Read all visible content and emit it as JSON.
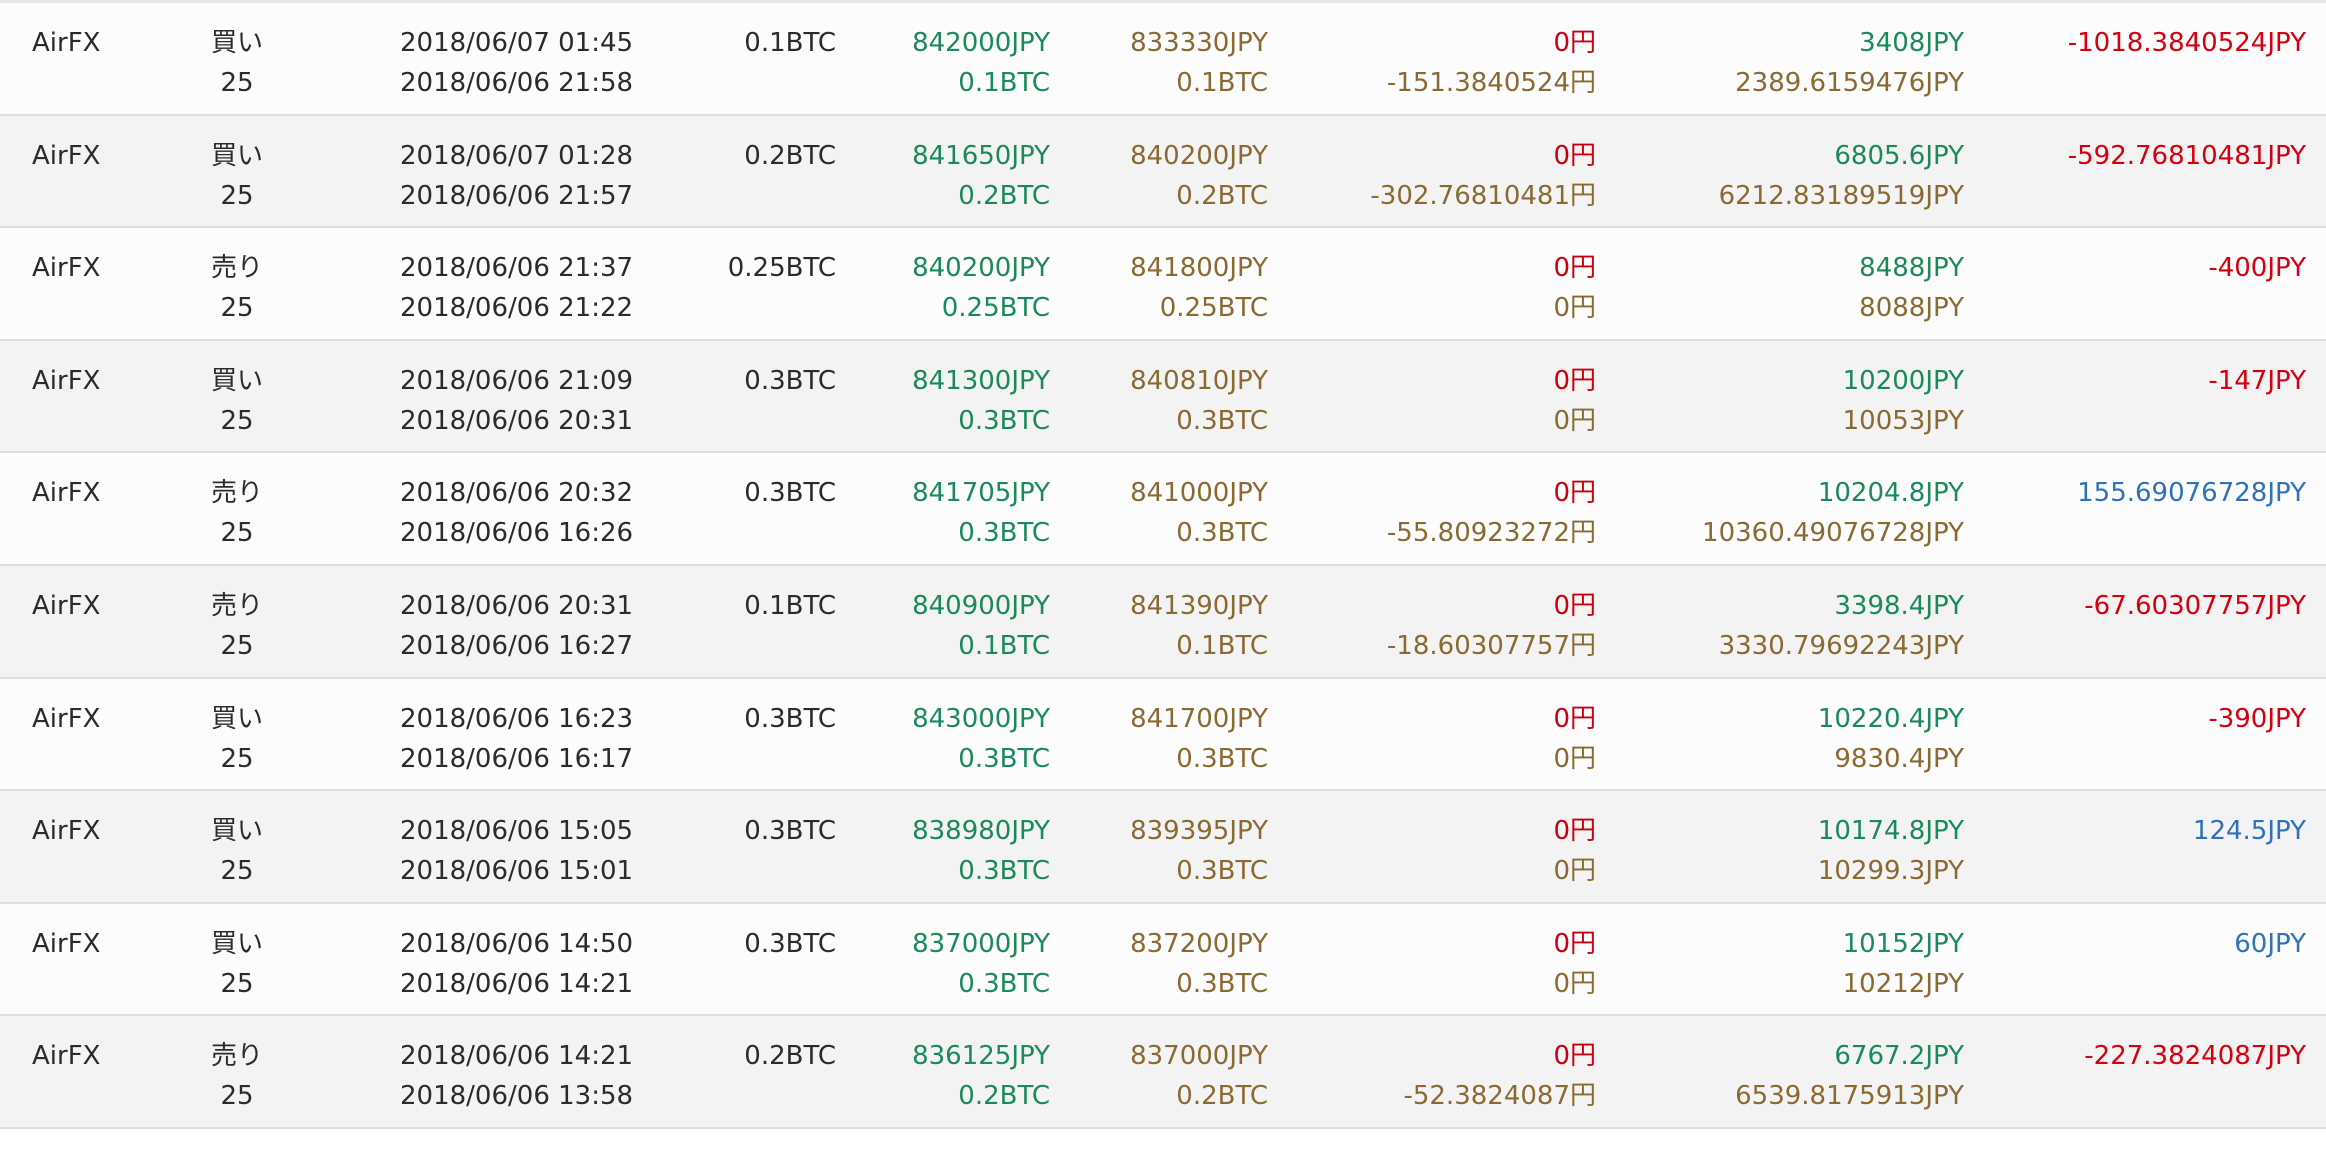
{
  "colors": {
    "open": "#1b8a5a",
    "close": "#8a6a32",
    "fee_zero": "#c8000f",
    "profit_negative": "#d4000f",
    "profit_positive": "#2f72b8"
  },
  "rows": [
    {
      "exchange": "AirFX",
      "side": "買い",
      "leverage": "25",
      "date_close": "2018/06/07 01:45",
      "date_open": "2018/06/06 21:58",
      "size": "0.1BTC",
      "open_price": "842000JPY",
      "open_amount": "0.1BTC",
      "close_price": "833330JPY",
      "close_amount": "0.1BTC",
      "fee": "0円",
      "swap": "-151.3840524円",
      "margin1": "3408JPY",
      "margin2": "2389.6159476JPY",
      "profit": "-1018.3840524JPY",
      "profit_sign": "neg"
    },
    {
      "exchange": "AirFX",
      "side": "買い",
      "leverage": "25",
      "date_close": "2018/06/07 01:28",
      "date_open": "2018/06/06 21:57",
      "size": "0.2BTC",
      "open_price": "841650JPY",
      "open_amount": "0.2BTC",
      "close_price": "840200JPY",
      "close_amount": "0.2BTC",
      "fee": "0円",
      "swap": "-302.76810481円",
      "margin1": "6805.6JPY",
      "margin2": "6212.83189519JPY",
      "profit": "-592.76810481JPY",
      "profit_sign": "neg"
    },
    {
      "exchange": "AirFX",
      "side": "売り",
      "leverage": "25",
      "date_close": "2018/06/06 21:37",
      "date_open": "2018/06/06 21:22",
      "size": "0.25BTC",
      "open_price": "840200JPY",
      "open_amount": "0.25BTC",
      "close_price": "841800JPY",
      "close_amount": "0.25BTC",
      "fee": "0円",
      "swap": "0円",
      "margin1": "8488JPY",
      "margin2": "8088JPY",
      "profit": "-400JPY",
      "profit_sign": "neg"
    },
    {
      "exchange": "AirFX",
      "side": "買い",
      "leverage": "25",
      "date_close": "2018/06/06 21:09",
      "date_open": "2018/06/06 20:31",
      "size": "0.3BTC",
      "open_price": "841300JPY",
      "open_amount": "0.3BTC",
      "close_price": "840810JPY",
      "close_amount": "0.3BTC",
      "fee": "0円",
      "swap": "0円",
      "margin1": "10200JPY",
      "margin2": "10053JPY",
      "profit": "-147JPY",
      "profit_sign": "neg"
    },
    {
      "exchange": "AirFX",
      "side": "売り",
      "leverage": "25",
      "date_close": "2018/06/06 20:32",
      "date_open": "2018/06/06 16:26",
      "size": "0.3BTC",
      "open_price": "841705JPY",
      "open_amount": "0.3BTC",
      "close_price": "841000JPY",
      "close_amount": "0.3BTC",
      "fee": "0円",
      "swap": "-55.80923272円",
      "margin1": "10204.8JPY",
      "margin2": "10360.49076728JPY",
      "profit": "155.69076728JPY",
      "profit_sign": "pos"
    },
    {
      "exchange": "AirFX",
      "side": "売り",
      "leverage": "25",
      "date_close": "2018/06/06 20:31",
      "date_open": "2018/06/06 16:27",
      "size": "0.1BTC",
      "open_price": "840900JPY",
      "open_amount": "0.1BTC",
      "close_price": "841390JPY",
      "close_amount": "0.1BTC",
      "fee": "0円",
      "swap": "-18.60307757円",
      "margin1": "3398.4JPY",
      "margin2": "3330.79692243JPY",
      "profit": "-67.60307757JPY",
      "profit_sign": "neg"
    },
    {
      "exchange": "AirFX",
      "side": "買い",
      "leverage": "25",
      "date_close": "2018/06/06 16:23",
      "date_open": "2018/06/06 16:17",
      "size": "0.3BTC",
      "open_price": "843000JPY",
      "open_amount": "0.3BTC",
      "close_price": "841700JPY",
      "close_amount": "0.3BTC",
      "fee": "0円",
      "swap": "0円",
      "margin1": "10220.4JPY",
      "margin2": "9830.4JPY",
      "profit": "-390JPY",
      "profit_sign": "neg"
    },
    {
      "exchange": "AirFX",
      "side": "買い",
      "leverage": "25",
      "date_close": "2018/06/06 15:05",
      "date_open": "2018/06/06 15:01",
      "size": "0.3BTC",
      "open_price": "838980JPY",
      "open_amount": "0.3BTC",
      "close_price": "839395JPY",
      "close_amount": "0.3BTC",
      "fee": "0円",
      "swap": "0円",
      "margin1": "10174.8JPY",
      "margin2": "10299.3JPY",
      "profit": "124.5JPY",
      "profit_sign": "pos"
    },
    {
      "exchange": "AirFX",
      "side": "買い",
      "leverage": "25",
      "date_close": "2018/06/06 14:50",
      "date_open": "2018/06/06 14:21",
      "size": "0.3BTC",
      "open_price": "837000JPY",
      "open_amount": "0.3BTC",
      "close_price": "837200JPY",
      "close_amount": "0.3BTC",
      "fee": "0円",
      "swap": "0円",
      "margin1": "10152JPY",
      "margin2": "10212JPY",
      "profit": "60JPY",
      "profit_sign": "pos"
    },
    {
      "exchange": "AirFX",
      "side": "売り",
      "leverage": "25",
      "date_close": "2018/06/06 14:21",
      "date_open": "2018/06/06 13:58",
      "size": "0.2BTC",
      "open_price": "836125JPY",
      "open_amount": "0.2BTC",
      "close_price": "837000JPY",
      "close_amount": "0.2BTC",
      "fee": "0円",
      "swap": "-52.3824087円",
      "margin1": "6767.2JPY",
      "margin2": "6539.8175913JPY",
      "profit": "-227.3824087JPY",
      "profit_sign": "neg"
    }
  ]
}
